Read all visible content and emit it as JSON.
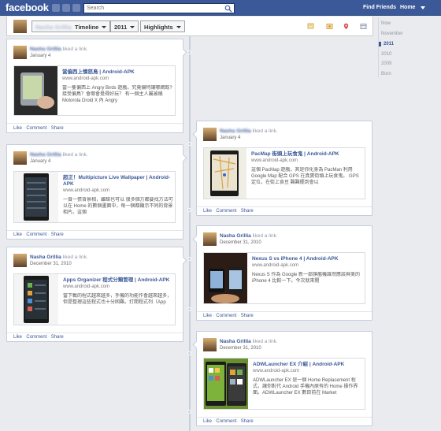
{
  "topbar": {
    "logo": "facebook",
    "search_placeholder": "Search",
    "find_friends": "Find Friends",
    "home": "Home"
  },
  "subbar": {
    "timeline_label": "Timeline",
    "year_label": "2011",
    "highlights_label": "Highlights",
    "profile_name": "Nasha Grillia"
  },
  "years": [
    "Now",
    "November",
    "2011",
    "2010",
    "2009",
    "Born"
  ],
  "years_selected": "2011",
  "posts": [
    {
      "author": "Nasha Grillia",
      "action": "liked a link.",
      "date": "January 4",
      "title": "當偏西上憤怒鳥 | Android-APK",
      "url": "www.android-apk.com",
      "desc": "當一隻偏西上 Angry Birds 遊戲，究竟偏特讓哪網既?接受偏鳥？會哪會覺得好玩？ 有一個主人屬被稱 Motorola Droid X 內 Angry",
      "actions": [
        "Like",
        "Comment",
        "Share"
      ]
    },
    {
      "author": "Nasha Grillia",
      "action": "liked a link.",
      "date": "January 4",
      "title": "PacMap 街頭上玩食鬼 | Android-APK",
      "url": "www.android-apk.com",
      "desc": "這個 PacMap 遊戲，其是你化身為 PacMan 利用 Google Map 配合 GPS 在真實街頭上玩食鬼。 GPS 定位，在街上食豆 難難擺到會以",
      "actions": [
        "Like",
        "Comment",
        "Share"
      ]
    },
    {
      "author": "Nasha Grillia",
      "action": "liked a link.",
      "date": "January 4",
      "title": "超正！Multipicture Live Wallpaper | Android-APK",
      "url": "www.android-apk.com",
      "desc": "一頁一張背景相，雖睇也可以 很多個方都要找方法可以在 Home 的數個畫面中，每一個都顯示不同的背景相片。這個",
      "actions": [
        "Like",
        "Comment",
        "Share"
      ]
    },
    {
      "author": "Nasha Grillia",
      "action": "liked a link.",
      "date": "December 31, 2010",
      "title": "Nexus S vs iPhone 4 | Android-APK",
      "url": "www.android-apk.com",
      "desc": "Nexus S 作為 Google 新一部旗艦機誰然應該與美的 iPhone 4 比較一下。今次就來開",
      "actions": [
        "Like",
        "Comment",
        "Share"
      ]
    },
    {
      "author": "Nasha Grillia",
      "action": "liked a link.",
      "date": "December 31, 2010",
      "title": "Apps Organizer 程式分類管理 | Android-APK",
      "url": "www.android-apk.com",
      "desc": "當下載的程式越來越多，手機的功能作會越來越多，但是整理這些程式也十分困難。打開程式列（App",
      "actions": [
        "Like",
        "Comment",
        "Share"
      ]
    },
    {
      "author": "Nasha Grillia",
      "action": "liked a link.",
      "date": "December 31, 2010",
      "title": "ADWLauncher EX 介紹 | Android-APK",
      "url": "www.android-apk.com",
      "desc": "ADWLauncher EX 是一個 Home Replacement 程式，讓你對代 Android 手機內原有的 Home 操作界面。ADWLauncher EX 數目前在 Market",
      "actions": [
        "Like",
        "Comment",
        "Share"
      ]
    }
  ],
  "colors": {
    "brand": "#3b5998",
    "link": "#3b5998",
    "background": "#e9ebee"
  }
}
